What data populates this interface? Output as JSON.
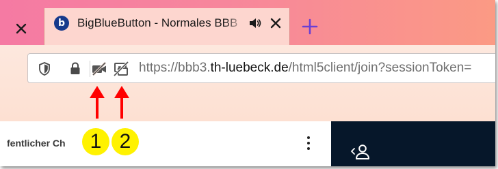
{
  "tabs": {
    "active_title": "BigBlueButton - Normales BBB",
    "favicon_letter": "b",
    "audio_icon": "speaker-icon",
    "close_icon": "close-icon",
    "new_tab_icon": "plus-icon"
  },
  "address_bar": {
    "url_prefix": "https://bbb3.",
    "url_host": "th-luebeck.de",
    "url_path": "/html5client/join?sessionToken=",
    "icons": [
      "tracking-protection-shield-icon",
      "lock-icon",
      "camera-blocked-icon",
      "screen-share-blocked-icon"
    ]
  },
  "annotations": {
    "labels": [
      "1",
      "2"
    ],
    "badge_color": "#fff200",
    "arrow_color": "#ff0000"
  },
  "chat_panel": {
    "title": "fentlicher Ch"
  },
  "user_panel": {
    "icon": "user-list-icon"
  },
  "colors": {
    "tabstrip": "#f57aa3",
    "active_tab": "#fdd6cf",
    "toolbar": "#fde8de",
    "sidebar_dark": "#06172a",
    "accent_plus": "#6a3fd4"
  }
}
